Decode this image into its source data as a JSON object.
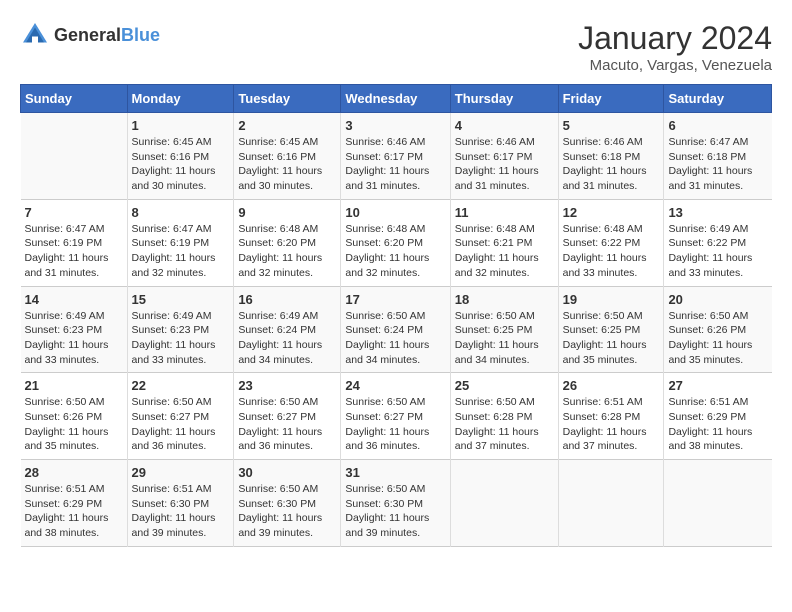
{
  "header": {
    "logo": {
      "general": "General",
      "blue": "Blue"
    },
    "title": "January 2024",
    "subtitle": "Macuto, Vargas, Venezuela"
  },
  "calendar": {
    "days_of_week": [
      "Sunday",
      "Monday",
      "Tuesday",
      "Wednesday",
      "Thursday",
      "Friday",
      "Saturday"
    ],
    "weeks": [
      [
        {
          "day": "",
          "info": ""
        },
        {
          "day": "1",
          "info": "Sunrise: 6:45 AM\nSunset: 6:16 PM\nDaylight: 11 hours\nand 30 minutes."
        },
        {
          "day": "2",
          "info": "Sunrise: 6:45 AM\nSunset: 6:16 PM\nDaylight: 11 hours\nand 30 minutes."
        },
        {
          "day": "3",
          "info": "Sunrise: 6:46 AM\nSunset: 6:17 PM\nDaylight: 11 hours\nand 31 minutes."
        },
        {
          "day": "4",
          "info": "Sunrise: 6:46 AM\nSunset: 6:17 PM\nDaylight: 11 hours\nand 31 minutes."
        },
        {
          "day": "5",
          "info": "Sunrise: 6:46 AM\nSunset: 6:18 PM\nDaylight: 11 hours\nand 31 minutes."
        },
        {
          "day": "6",
          "info": "Sunrise: 6:47 AM\nSunset: 6:18 PM\nDaylight: 11 hours\nand 31 minutes."
        }
      ],
      [
        {
          "day": "7",
          "info": "Sunrise: 6:47 AM\nSunset: 6:19 PM\nDaylight: 11 hours\nand 31 minutes."
        },
        {
          "day": "8",
          "info": "Sunrise: 6:47 AM\nSunset: 6:19 PM\nDaylight: 11 hours\nand 32 minutes."
        },
        {
          "day": "9",
          "info": "Sunrise: 6:48 AM\nSunset: 6:20 PM\nDaylight: 11 hours\nand 32 minutes."
        },
        {
          "day": "10",
          "info": "Sunrise: 6:48 AM\nSunset: 6:20 PM\nDaylight: 11 hours\nand 32 minutes."
        },
        {
          "day": "11",
          "info": "Sunrise: 6:48 AM\nSunset: 6:21 PM\nDaylight: 11 hours\nand 32 minutes."
        },
        {
          "day": "12",
          "info": "Sunrise: 6:48 AM\nSunset: 6:22 PM\nDaylight: 11 hours\nand 33 minutes."
        },
        {
          "day": "13",
          "info": "Sunrise: 6:49 AM\nSunset: 6:22 PM\nDaylight: 11 hours\nand 33 minutes."
        }
      ],
      [
        {
          "day": "14",
          "info": "Sunrise: 6:49 AM\nSunset: 6:23 PM\nDaylight: 11 hours\nand 33 minutes."
        },
        {
          "day": "15",
          "info": "Sunrise: 6:49 AM\nSunset: 6:23 PM\nDaylight: 11 hours\nand 33 minutes."
        },
        {
          "day": "16",
          "info": "Sunrise: 6:49 AM\nSunset: 6:24 PM\nDaylight: 11 hours\nand 34 minutes."
        },
        {
          "day": "17",
          "info": "Sunrise: 6:50 AM\nSunset: 6:24 PM\nDaylight: 11 hours\nand 34 minutes."
        },
        {
          "day": "18",
          "info": "Sunrise: 6:50 AM\nSunset: 6:25 PM\nDaylight: 11 hours\nand 34 minutes."
        },
        {
          "day": "19",
          "info": "Sunrise: 6:50 AM\nSunset: 6:25 PM\nDaylight: 11 hours\nand 35 minutes."
        },
        {
          "day": "20",
          "info": "Sunrise: 6:50 AM\nSunset: 6:26 PM\nDaylight: 11 hours\nand 35 minutes."
        }
      ],
      [
        {
          "day": "21",
          "info": "Sunrise: 6:50 AM\nSunset: 6:26 PM\nDaylight: 11 hours\nand 35 minutes."
        },
        {
          "day": "22",
          "info": "Sunrise: 6:50 AM\nSunset: 6:27 PM\nDaylight: 11 hours\nand 36 minutes."
        },
        {
          "day": "23",
          "info": "Sunrise: 6:50 AM\nSunset: 6:27 PM\nDaylight: 11 hours\nand 36 minutes."
        },
        {
          "day": "24",
          "info": "Sunrise: 6:50 AM\nSunset: 6:27 PM\nDaylight: 11 hours\nand 36 minutes."
        },
        {
          "day": "25",
          "info": "Sunrise: 6:50 AM\nSunset: 6:28 PM\nDaylight: 11 hours\nand 37 minutes."
        },
        {
          "day": "26",
          "info": "Sunrise: 6:51 AM\nSunset: 6:28 PM\nDaylight: 11 hours\nand 37 minutes."
        },
        {
          "day": "27",
          "info": "Sunrise: 6:51 AM\nSunset: 6:29 PM\nDaylight: 11 hours\nand 38 minutes."
        }
      ],
      [
        {
          "day": "28",
          "info": "Sunrise: 6:51 AM\nSunset: 6:29 PM\nDaylight: 11 hours\nand 38 minutes."
        },
        {
          "day": "29",
          "info": "Sunrise: 6:51 AM\nSunset: 6:30 PM\nDaylight: 11 hours\nand 39 minutes."
        },
        {
          "day": "30",
          "info": "Sunrise: 6:50 AM\nSunset: 6:30 PM\nDaylight: 11 hours\nand 39 minutes."
        },
        {
          "day": "31",
          "info": "Sunrise: 6:50 AM\nSunset: 6:30 PM\nDaylight: 11 hours\nand 39 minutes."
        },
        {
          "day": "",
          "info": ""
        },
        {
          "day": "",
          "info": ""
        },
        {
          "day": "",
          "info": ""
        }
      ]
    ]
  }
}
